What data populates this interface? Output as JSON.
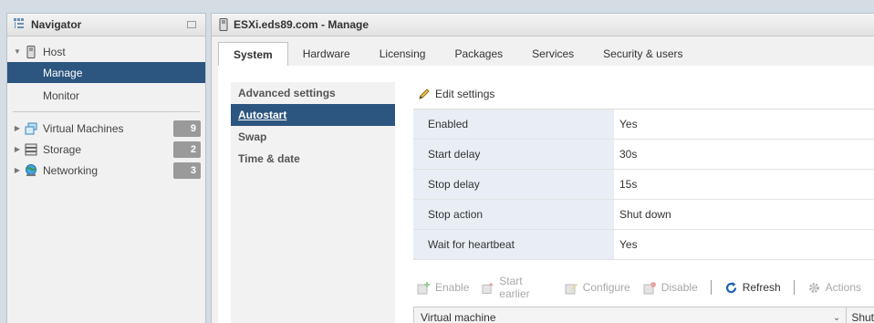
{
  "navigator": {
    "title": "Navigator",
    "host": {
      "label": "Host",
      "children": [
        {
          "label": "Manage"
        },
        {
          "label": "Monitor"
        }
      ]
    },
    "virtual_machines": {
      "label": "Virtual Machines",
      "count": "9"
    },
    "storage": {
      "label": "Storage",
      "count": "2"
    },
    "networking": {
      "label": "Networking",
      "count": "3"
    }
  },
  "main": {
    "title": "ESXi.eds89.com - Manage",
    "tabs": [
      {
        "label": "System"
      },
      {
        "label": "Hardware"
      },
      {
        "label": "Licensing"
      },
      {
        "label": "Packages"
      },
      {
        "label": "Services"
      },
      {
        "label": "Security & users"
      }
    ],
    "subnav": [
      {
        "label": "Advanced settings"
      },
      {
        "label": "Autostart"
      },
      {
        "label": "Swap"
      },
      {
        "label": "Time & date"
      }
    ],
    "edit_settings": "Edit settings",
    "settings": [
      {
        "key": "Enabled",
        "value": "Yes"
      },
      {
        "key": "Start delay",
        "value": "30s"
      },
      {
        "key": "Stop delay",
        "value": "15s"
      },
      {
        "key": "Stop action",
        "value": "Shut down"
      },
      {
        "key": "Wait for heartbeat",
        "value": "Yes"
      }
    ],
    "toolbar": {
      "enable": "Enable",
      "start_earlier": "Start earlier",
      "configure": "Configure",
      "disable": "Disable",
      "refresh": "Refresh",
      "actions": "Actions"
    },
    "table": {
      "col1": "Virtual machine",
      "col2": "Shut"
    }
  },
  "colors": {
    "selected": "#2c557f",
    "key_bg": "#e8eef4",
    "badge": "#9a9a9a"
  }
}
